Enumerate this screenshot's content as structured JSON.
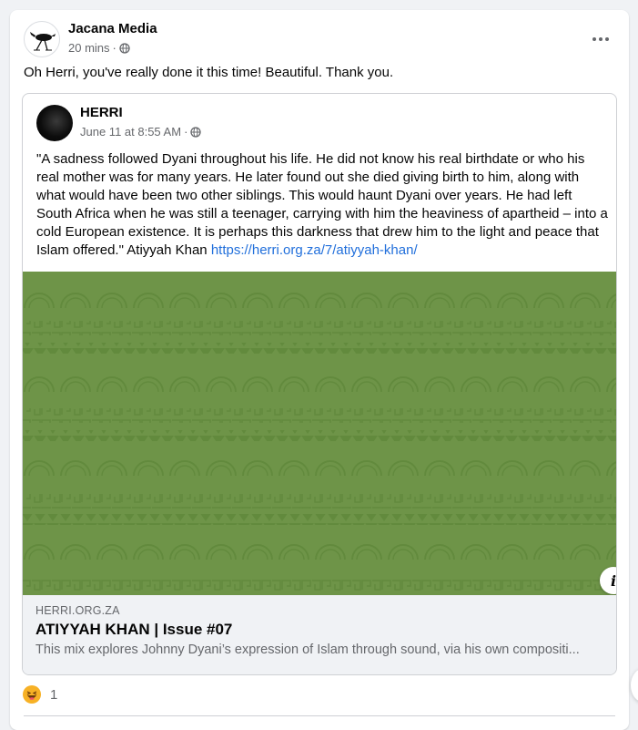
{
  "post": {
    "author": "Jacana Media",
    "time": "20 mins",
    "separator": "·",
    "audience_icon": "globe-icon",
    "more_icon": "more-options-icon",
    "text": "Oh Herri, you've really done it this time! Beautiful. Thank you."
  },
  "shared": {
    "author": "HERRI",
    "time": "June 11 at 8:55 AM",
    "separator": "·",
    "audience_icon": "globe-icon",
    "quote": "\"A sadness followed Dyani throughout his life. He did not know his real birthdate or who his real mother was for many years. He later found out she died giving birth to him, along with what would have been two other siblings. This would haunt Dyani over years. He had left South Africa when he was still a teenager, carrying with him the heaviness of apartheid – into a cold European existence. It is perhaps this darkness that drew him to the light and peace that Islam offered.\" Atiyyah Khan ",
    "link_text": "https://herri.org.za/7/atiyyah-khan/"
  },
  "link_preview": {
    "domain": "HERRI.ORG.ZA",
    "title": "ATIYYAH KHAN | Issue #07",
    "description": "This mix explores Johnny Dyani’s expression of Islam through sound, via his own compositi...",
    "info_label": "i",
    "image_color": "#6e9448"
  },
  "reactions": {
    "count": "1",
    "icon": "haha-reaction-icon"
  },
  "colors": {
    "link": "#216fdb",
    "muted": "#65676b",
    "card_bg": "#ffffff",
    "page_bg": "#f0f2f5"
  }
}
